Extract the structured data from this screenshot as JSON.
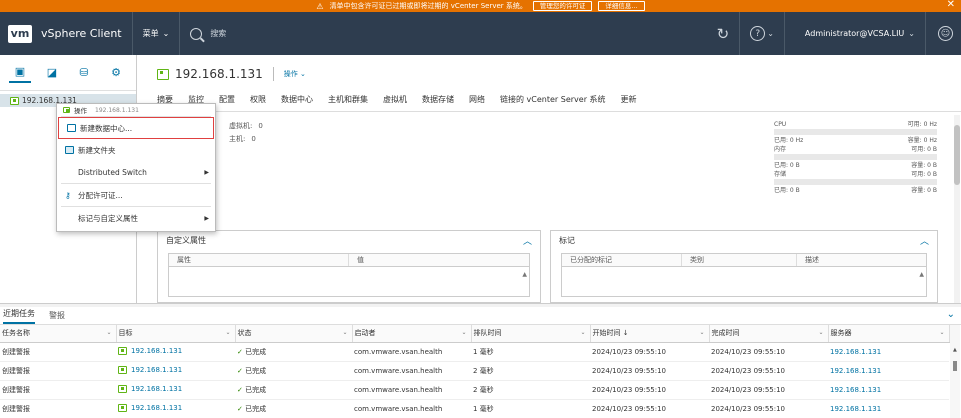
{
  "alert": {
    "message": "清单中包含许可证已过期或即将过期的 vCenter Server 系统。",
    "btn_manage": "管理您的许可证",
    "btn_details": "详细信息...",
    "close": "✕"
  },
  "header": {
    "logo": "vm",
    "app_title": "vSphere Client",
    "menu_label": "菜单",
    "search_placeholder": "搜索",
    "user": "Administrator@VCSA.LIU"
  },
  "tree": {
    "host": "192.168.1.131"
  },
  "context_menu": {
    "header_label": "操作",
    "header_host": "192.168.1.131",
    "items": [
      {
        "label": "新建数据中心..."
      },
      {
        "label": "新建文件夹"
      },
      {
        "label": "Distributed Switch"
      },
      {
        "label": "分配许可证..."
      },
      {
        "label": "标记与自定义属性"
      }
    ]
  },
  "object": {
    "title": "192.168.1.131",
    "actions": "操作"
  },
  "tabs": [
    "摘要",
    "监控",
    "配置",
    "权限",
    "数据中心",
    "主机和群集",
    "虚拟机",
    "数据存储",
    "网络",
    "链接的 vCenter Server 系统",
    "更新"
  ],
  "summary": {
    "vm_label": "虚拟机:",
    "vm_value": "0",
    "host_label": "主机:",
    "host_value": "0"
  },
  "resources": {
    "cpu": "CPU",
    "cpu_free": "可用: 0 Hz",
    "cpu_used": "已用: 0 Hz",
    "cpu_cap": "容量: 0 Hz",
    "mem": "内存",
    "mem_free": "可用: 0 B",
    "mem_used": "已用: 0 B",
    "mem_cap": "容量: 0 B",
    "storage": "存储",
    "sto_free": "可用: 0 B",
    "sto_used": "已用: 0 B",
    "sto_cap": "容量: 0 B"
  },
  "custom_attrs": {
    "title": "自定义属性",
    "col_attr": "属性",
    "col_value": "值"
  },
  "tags": {
    "title": "标记",
    "col_assigned": "已分配的标记",
    "col_category": "类别",
    "col_desc": "描述"
  },
  "bottom_tabs": [
    "近期任务",
    "警报"
  ],
  "task_columns": [
    "任务名称",
    "目标",
    "状态",
    "启动者",
    "排队时间",
    "开始时间 ↓",
    "完成时间",
    "服务器"
  ],
  "tasks": [
    {
      "name": "创建警报",
      "target": "192.168.1.131",
      "status": "已完成",
      "initiator": "com.vmware.vsan.health",
      "queued": "1 毫秒",
      "start": "2024/10/23 09:55:10",
      "end": "2024/10/23 09:55:10",
      "server": "192.168.1.131"
    },
    {
      "name": "创建警报",
      "target": "192.168.1.131",
      "status": "已完成",
      "initiator": "com.vmware.vsan.health",
      "queued": "2 毫秒",
      "start": "2024/10/23 09:55:10",
      "end": "2024/10/23 09:55:10",
      "server": "192.168.1.131"
    },
    {
      "name": "创建警报",
      "target": "192.168.1.131",
      "status": "已完成",
      "initiator": "com.vmware.vsan.health",
      "queued": "2 毫秒",
      "start": "2024/10/23 09:55:10",
      "end": "2024/10/23 09:55:10",
      "server": "192.168.1.131"
    },
    {
      "name": "创建警报",
      "target": "192.168.1.131",
      "status": "已完成",
      "initiator": "com.vmware.vsan.health",
      "queued": "1 毫秒",
      "start": "2024/10/23 09:55:10",
      "end": "2024/10/23 09:55:10",
      "server": "192.168.1.131"
    }
  ]
}
